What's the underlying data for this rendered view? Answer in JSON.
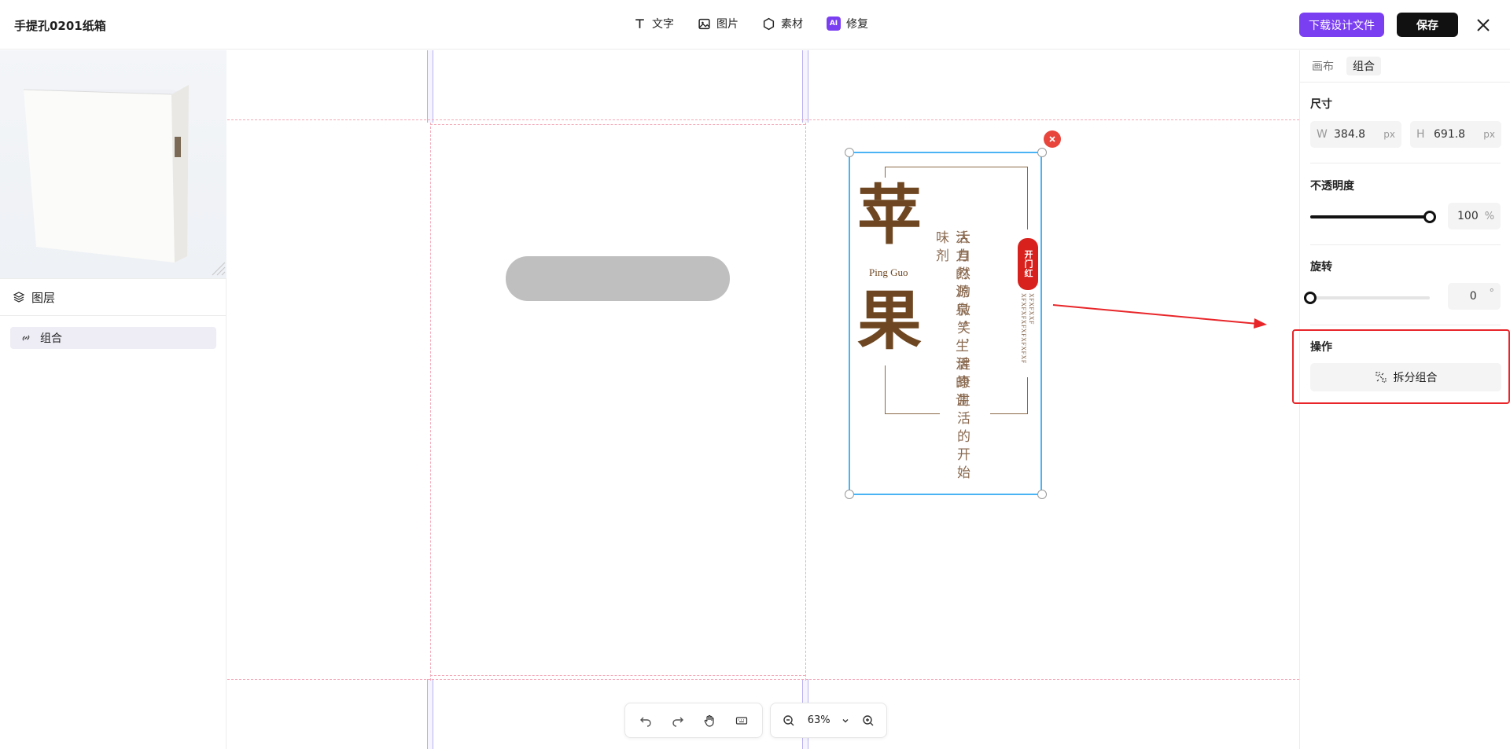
{
  "header": {
    "doc_title": "手提孔0201纸箱",
    "tools": {
      "text": "文字",
      "image": "图片",
      "material": "素材",
      "repair": "修复",
      "ai_badge": "AI"
    },
    "download_label": "下载设计文件",
    "save_label": "保存"
  },
  "colors": {
    "accent": "#7b3ff2",
    "selection": "#4ab3f4",
    "guide": "#f4a8b8",
    "artwork_brown": "#6e4722",
    "seal_red": "#d8201c",
    "annotation_red": "#e8262a"
  },
  "left_panel": {
    "layers_title": "图层",
    "layers": [
      {
        "label": "组合",
        "icon": "group-link-icon"
      }
    ]
  },
  "artwork": {
    "char_top": "苹",
    "char_bottom": "果",
    "pinyin": "Ping Guo",
    "poem_right": "大自然的微笑，健康生活的开始",
    "poem_left": "活力的源泉，生活的调味剂",
    "seal_text": "开门红",
    "small_text_1": "XFXFXXF",
    "small_text_2": "XFXFXFXFXFXFXFXF"
  },
  "bottom_toolbar": {
    "zoom": "63%",
    "icons": [
      "undo-icon",
      "redo-icon",
      "hand-icon",
      "keyboard-icon",
      "zoom-out-icon",
      "chevron-down-icon",
      "zoom-in-icon"
    ]
  },
  "right_panel": {
    "tabs": [
      "画布",
      "组合"
    ],
    "active_tab": "组合",
    "size": {
      "label": "尺寸",
      "w_label": "W",
      "w_value": "384.8",
      "h_label": "H",
      "h_value": "691.8",
      "unit": "px"
    },
    "opacity": {
      "label": "不透明度",
      "value": "100",
      "unit": "%",
      "fraction": 1.0
    },
    "rotation": {
      "label": "旋转",
      "value": "0",
      "unit": "°",
      "fraction": 0.0
    },
    "operation": {
      "label": "操作",
      "ungroup_label": "拆分组合"
    }
  }
}
